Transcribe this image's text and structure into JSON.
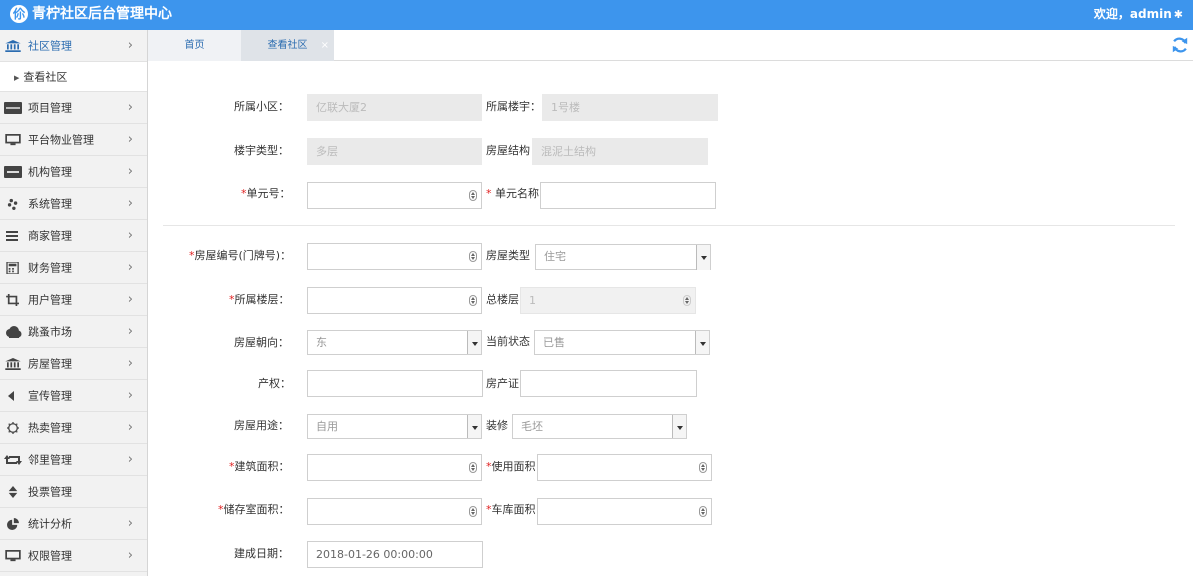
{
  "header": {
    "title": "青柠社区后台管理中心",
    "logo": "伱",
    "welcome": "欢迎，admin"
  },
  "sidebar": {
    "items": [
      {
        "label": "社区管理",
        "icon": "bank-icon"
      },
      {
        "label": "项目管理",
        "icon": "discover-card-icon"
      },
      {
        "label": "平台物业管理",
        "icon": "monitor-icon"
      },
      {
        "label": "机构管理",
        "icon": "stripe-icon"
      },
      {
        "label": "系统管理",
        "icon": "yelp-icon"
      },
      {
        "label": "商家管理",
        "icon": "bars-icon"
      },
      {
        "label": "财务管理",
        "icon": "calculator-icon"
      },
      {
        "label": "用户管理",
        "icon": "crop-icon"
      },
      {
        "label": "跳蚤市场",
        "icon": "cloud-icon"
      },
      {
        "label": "房屋管理",
        "icon": "bank-icon"
      },
      {
        "label": "宣传管理",
        "icon": "volume-icon"
      },
      {
        "label": "热卖管理",
        "icon": "sun-icon"
      },
      {
        "label": "邻里管理",
        "icon": "retweet-icon"
      },
      {
        "label": "投票管理",
        "icon": "sort-icon"
      },
      {
        "label": "统计分析",
        "icon": "pie-chart-icon"
      },
      {
        "label": "权限管理",
        "icon": "monitor-icon"
      }
    ],
    "submenu": {
      "label": "查看社区"
    }
  },
  "tabs": {
    "home": "首页",
    "current": "查看社区",
    "close": "×"
  },
  "form": {
    "community": {
      "label": "所属小区：",
      "value": "亿联大厦2"
    },
    "building": {
      "label": "所属楼宇：",
      "value": "1号楼"
    },
    "building_type": {
      "label": "楼宇类型：",
      "value": "多层"
    },
    "structure": {
      "label": "房屋结构",
      "value": "混泥土结构"
    },
    "unit_no": {
      "star": "*",
      "label": "单元号：",
      "value": ""
    },
    "unit_name": {
      "star": "* ",
      "label": "单元名称",
      "value": ""
    },
    "house_no": {
      "star": "*",
      "label": "房屋编号(门牌号)：",
      "value": ""
    },
    "house_type": {
      "label": "房屋类型",
      "value": "住宅"
    },
    "floor": {
      "star": "*",
      "label": "所属楼层：",
      "value": ""
    },
    "total_floors": {
      "label": "总楼层",
      "value": "1"
    },
    "orientation": {
      "label": "房屋朝向：",
      "value": "东"
    },
    "status": {
      "label": "当前状态",
      "value": "已售"
    },
    "property_right": {
      "label": "产权：",
      "value": ""
    },
    "certificate": {
      "label": "房产证",
      "value": ""
    },
    "usage": {
      "label": "房屋用途：",
      "value": "自用"
    },
    "decoration": {
      "label": "装修",
      "value": "毛坯"
    },
    "build_area": {
      "star": "*",
      "label": "建筑面积：",
      "value": ""
    },
    "use_area": {
      "star": "*",
      "label": "使用面积",
      "value": ""
    },
    "storage_area": {
      "star": "*",
      "label": "储存室面积：",
      "value": ""
    },
    "garage_area": {
      "star": "*",
      "label": "车库面积",
      "value": ""
    },
    "build_date": {
      "label": "建成日期：",
      "value": "2018-01-26 00:00:00"
    }
  },
  "colors": {
    "header": "#3d95ed",
    "required": "#e02020",
    "tab_text": "#2b6cb0"
  }
}
